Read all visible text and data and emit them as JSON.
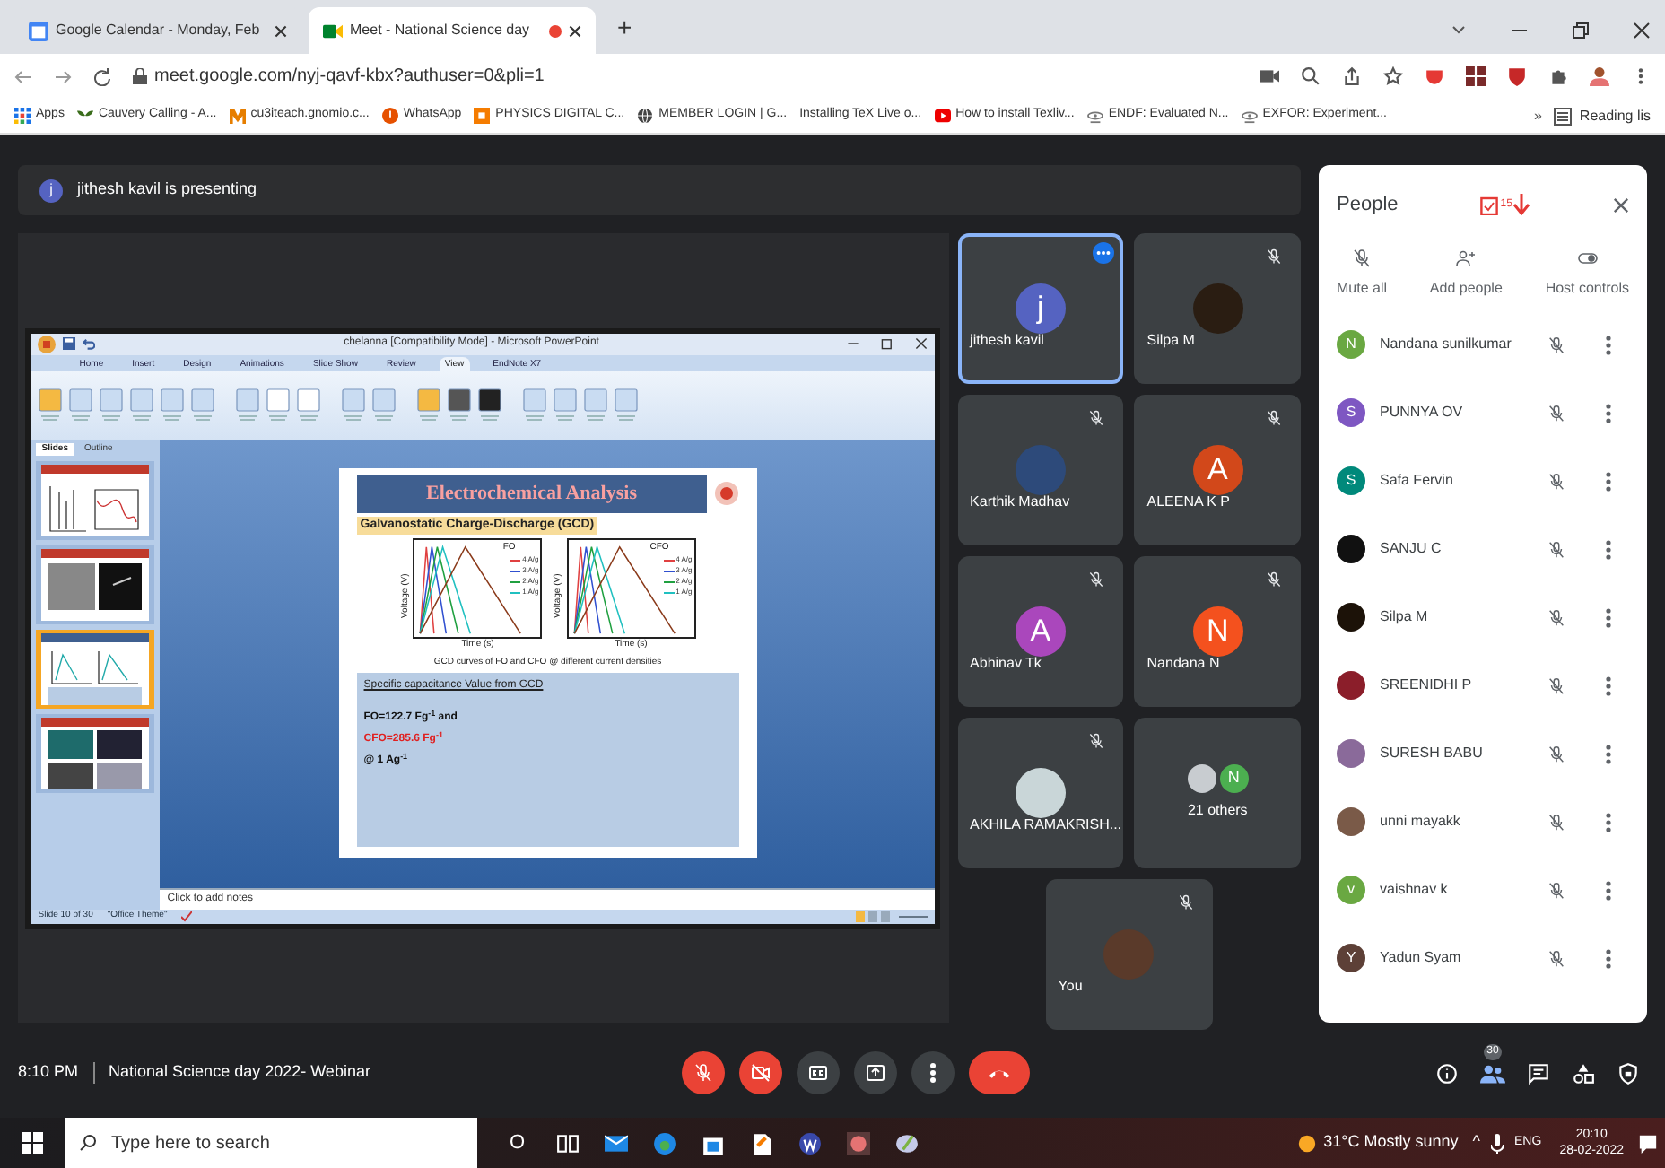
{
  "browser": {
    "tabs": [
      {
        "title": "Google Calendar - Monday, Feb",
        "selected": false,
        "recording": false
      },
      {
        "title": "Meet - National Science day",
        "selected": true,
        "recording": true
      }
    ],
    "new_tab": "+",
    "url": "meet.google.com/nyj-qavf-kbx?authuser=0&pli=1",
    "bookmarks": [
      "Apps",
      "Cauvery Calling - A...",
      "cu3iteach.gnomio.c...",
      "WhatsApp",
      "PHYSICS DIGITAL C...",
      "MEMBER LOGIN | G...",
      "Installing TeX Live o...",
      "How to install Texliv...",
      "ENDF: Evaluated N...",
      "EXFOR: Experiment..."
    ],
    "more": "»",
    "reading_list": "Reading lis"
  },
  "presenting": {
    "initial": "j",
    "text": "jithesh kavil is presenting"
  },
  "powerpoint": {
    "title": "chelanna [Compatibility Mode] - Microsoft PowerPoint",
    "tabs": [
      {
        "label": "Home",
        "selected": false
      },
      {
        "label": "Insert",
        "selected": false
      },
      {
        "label": "Design",
        "selected": false
      },
      {
        "label": "Animations",
        "selected": false
      },
      {
        "label": "Slide Show",
        "selected": false
      },
      {
        "label": "Review",
        "selected": false
      },
      {
        "label": "View",
        "selected": true
      },
      {
        "label": "EndNote X7",
        "selected": false
      }
    ],
    "pane_tabs": [
      {
        "label": "Slides",
        "selected": true
      },
      {
        "label": "Outline",
        "selected": false
      }
    ],
    "thumbnails": [
      {
        "selected": false
      },
      {
        "selected": false
      },
      {
        "selected": true
      },
      {
        "selected": false
      }
    ],
    "notes": "Click to add notes",
    "status": [
      "Slide 10 of 30",
      "\"Office Theme\""
    ],
    "slide": {
      "title": "Electrochemical Analysis",
      "subtitle": "Galvanostatic Charge-Discharge (GCD)",
      "charts": [
        {
          "name": "FO",
          "ylabel": "Voltage (V)",
          "xlabel": "Time (s)",
          "legend": [
            "4 A/g",
            "3 A/g",
            "2 A/g",
            "1 A/g"
          ]
        },
        {
          "name": "CFO",
          "ylabel": "Voltage (V)",
          "xlabel": "Time (s)",
          "legend": [
            "4 A/g",
            "3 A/g",
            "2 A/g",
            "1 A/g"
          ]
        }
      ],
      "caption": "GCD curves of FO and CFO @ different current densities",
      "box_heading": "Specific capacitance Value from GCD",
      "lines": [
        {
          "text": "FO=122.7 Fg$^{-1}$ and",
          "highlight": false
        },
        {
          "text": "CFO=285.6 Fg$^{-1}$",
          "highlight": true
        },
        {
          "text": "@ 1 Ag$^{-1}$",
          "highlight": false
        }
      ]
    }
  },
  "tiles": [
    {
      "name": "jithesh kavil",
      "kind": "letter",
      "initial": "j",
      "color": "#5563c1",
      "muted": false,
      "selected": true
    },
    {
      "name": "Silpa M",
      "kind": "photo",
      "color": "#2a1d12",
      "muted": true,
      "selected": false
    },
    {
      "name": "Karthik Madhav",
      "kind": "photo",
      "color": "#2d4a7a",
      "muted": true,
      "selected": false
    },
    {
      "name": "ALEENA K P",
      "kind": "letter",
      "initial": "A",
      "color": "#d2481a",
      "muted": true,
      "selected": false
    },
    {
      "name": "Abhinav Tk",
      "kind": "letter",
      "initial": "A",
      "color": "#aa47bc",
      "muted": true,
      "selected": false
    },
    {
      "name": "Nandana N",
      "kind": "letter",
      "initial": "N",
      "color": "#f4511e",
      "muted": true,
      "selected": false
    },
    {
      "name": "AKHILA RAMAKRISH...",
      "kind": "photo",
      "color": "#c9d6d8",
      "muted": true,
      "selected": false
    },
    {
      "name": "21 others",
      "kind": "others",
      "initial": "N",
      "color": "#4caf50",
      "muted": false,
      "selected": false
    },
    {
      "name": "You",
      "kind": "photo",
      "color": "#5a3a2a",
      "muted": true,
      "selected": false
    }
  ],
  "people": {
    "title": "People",
    "badge": "15",
    "actions": [
      "Mute all",
      "Add people",
      "Host controls"
    ],
    "list": [
      {
        "name": "Nandana sunilkumar",
        "kind": "letter",
        "initial": "N",
        "color": "#6aa842"
      },
      {
        "name": "PUNNYA OV",
        "kind": "letter",
        "initial": "S",
        "color": "#7e57c2"
      },
      {
        "name": "Safa Fervin",
        "kind": "letter",
        "initial": "S",
        "color": "#00897b"
      },
      {
        "name": "SANJU C",
        "kind": "photo",
        "color": "#111111"
      },
      {
        "name": "Silpa M",
        "kind": "photo",
        "color": "#1c1208"
      },
      {
        "name": "SREENIDHI P",
        "kind": "photo",
        "color": "#8b1e2a"
      },
      {
        "name": "SURESH BABU",
        "kind": "photo",
        "color": "#8a6a9a"
      },
      {
        "name": "unni mayakk",
        "kind": "photo",
        "color": "#7a5a48"
      },
      {
        "name": "vaishnav k",
        "kind": "letter",
        "initial": "v",
        "color": "#6aa842"
      },
      {
        "name": "Yadun Syam",
        "kind": "letter",
        "initial": "Y",
        "color": "#5d4037"
      }
    ]
  },
  "bottom": {
    "time": "8:10 PM",
    "meeting": "National Science day 2022- Webinar",
    "participants": "30"
  },
  "taskbar": {
    "search": "Type here to search",
    "cortana": "O",
    "weather": "31°C Mostly sunny",
    "caret": "^",
    "language": "ENG",
    "time": "20:10",
    "date": "28-02-2022"
  }
}
